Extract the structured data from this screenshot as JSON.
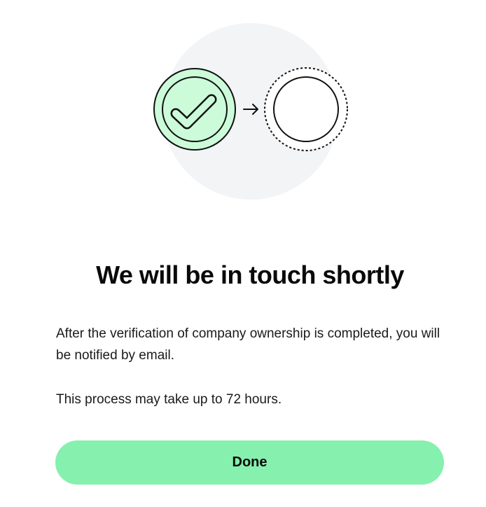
{
  "illustration": {
    "icons": [
      "check-icon",
      "arrow-right-icon",
      "pending-circle-icon"
    ],
    "colors": {
      "background_circle": "#f3f4f6",
      "check_fill": "#ccfbd9",
      "stroke": "#111111"
    }
  },
  "title": "We will be in touch shortly",
  "body": {
    "paragraph_1": "After the verification of company ownership is completed, you will be notified by email.",
    "paragraph_2": "This process may take up to 72 hours."
  },
  "actions": {
    "done_label": "Done",
    "done_color": "#86f0ae"
  }
}
